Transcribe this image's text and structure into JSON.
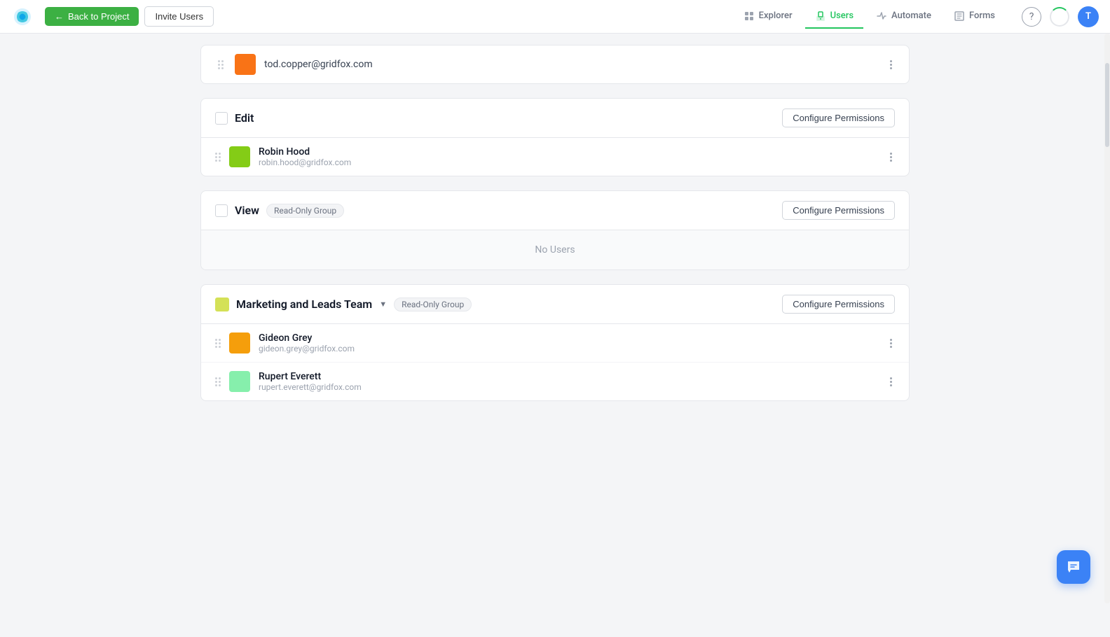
{
  "nav": {
    "back_label": "Back to Project",
    "invite_label": "Invite Users",
    "items": [
      {
        "id": "explorer",
        "label": "Explorer",
        "active": false
      },
      {
        "id": "users",
        "label": "Users",
        "active": true
      },
      {
        "id": "automate",
        "label": "Automate",
        "active": false
      },
      {
        "id": "forms",
        "label": "Forms",
        "active": false
      }
    ],
    "avatar_initial": "T"
  },
  "sections": {
    "partial_user": {
      "email": "tod.copper@gridfox.com",
      "avatar_color": "#f97316"
    },
    "edit": {
      "title": "Edit",
      "configure_label": "Configure Permissions",
      "users": [
        {
          "name": "Robin Hood",
          "email": "robin.hood@gridfox.com",
          "avatar_color": "#84cc16"
        }
      ]
    },
    "view": {
      "title": "View",
      "badge": "Read-Only Group",
      "configure_label": "Configure Permissions",
      "no_users_label": "No Users",
      "users": []
    },
    "marketing": {
      "title": "Marketing and Leads Team",
      "badge": "Read-Only Group",
      "configure_label": "Configure Permissions",
      "icon_color": "#d4e157",
      "users": [
        {
          "name": "Gideon Grey",
          "email": "gideon.grey@gridfox.com",
          "avatar_color": "#f59e0b"
        },
        {
          "name": "Rupert Everett",
          "email": "rupert.everett@gridfox.com",
          "avatar_color": "#86efac"
        }
      ]
    }
  }
}
